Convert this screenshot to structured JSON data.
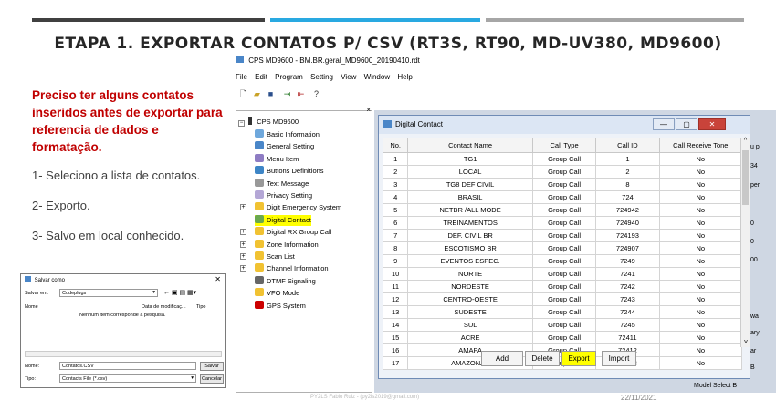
{
  "colors": {
    "bar1": "#404040",
    "bar2": "#29a9e1",
    "bar3": "#a6a6a6",
    "note": "#c00000",
    "highlight": "#ffff00"
  },
  "slide": {
    "title": "ETAPA 1. EXPORTAR CONTATOS P/ CSV (RT3S, RT90, MD-UV380, MD9600)",
    "note": "Preciso ter alguns contatos inseridos antes de exportar para referencia de dados e formatação.",
    "steps": [
      "1- Seleciono a lista de contatos.",
      "2- Exporto.",
      "3- Salvo em local conhecido."
    ],
    "footer_left": "PY2LS Fabio Ruiz - (py2ls2019@gmail.com)",
    "footer_date": "22/11/2021"
  },
  "save_dialog": {
    "title": "Salvar como",
    "close": "✕",
    "save_in_label": "Salvar em:",
    "save_in_value": "Codeplugs",
    "col_name": "Nome",
    "col_date": "Data de modificaç...",
    "col_type": "Tipo",
    "empty_message": "Nenhum item corresponde à pesquisa.",
    "filename_label": "Nome:",
    "filename_value": "Contatos.CSV",
    "type_label": "Tipo:",
    "type_value": "Contacts File (*.csv)",
    "save_button": "Salvar",
    "cancel_button": "Cancelar"
  },
  "cps": {
    "window_title": "CPS MD9600 - BM.BR.geral_MD9600_20190410.rdt",
    "menu": [
      "File",
      "Edit",
      "Program",
      "Setting",
      "View",
      "Window",
      "Help"
    ],
    "toolbar_icons": [
      "new-icon",
      "open-icon",
      "save-icon",
      "read-icon",
      "write-icon",
      "help-icon"
    ],
    "tree_root": "CPS MD9600",
    "tree": [
      {
        "label": "Basic Information",
        "icon": "basic-info-icon",
        "color": "#6fa8dc",
        "expandable": false
      },
      {
        "label": "General Setting",
        "icon": "general-setting-icon",
        "color": "#4a86c8",
        "expandable": false
      },
      {
        "label": "Menu Item",
        "icon": "menu-item-icon",
        "color": "#8e7cc3",
        "expandable": false
      },
      {
        "label": "Buttons Definitions",
        "icon": "buttons-icon",
        "color": "#3d85c6",
        "expandable": false
      },
      {
        "label": "Text Message",
        "icon": "text-message-icon",
        "color": "#999999",
        "expandable": false
      },
      {
        "label": "Privacy Setting",
        "icon": "privacy-icon",
        "color": "#b4a7d6",
        "expandable": false
      },
      {
        "label": "Digit Emergency System",
        "icon": "folder-icon",
        "color": "#f1c232",
        "expandable": true
      },
      {
        "label": "Digital Contact",
        "icon": "digital-contact-icon",
        "color": "#6aa84f",
        "expandable": false,
        "highlight": true
      },
      {
        "label": "Digital RX Group Call",
        "icon": "folder-icon",
        "color": "#f1c232",
        "expandable": true
      },
      {
        "label": "Zone Information",
        "icon": "folder-icon",
        "color": "#f1c232",
        "expandable": true
      },
      {
        "label": "Scan List",
        "icon": "folder-icon",
        "color": "#f1c232",
        "expandable": true
      },
      {
        "label": "Channel Information",
        "icon": "folder-icon",
        "color": "#f1c232",
        "expandable": true
      },
      {
        "label": "DTMF Signaling",
        "icon": "dtmf-icon",
        "color": "#666666",
        "expandable": false
      },
      {
        "label": "VFO Mode",
        "icon": "folder-icon",
        "color": "#f1c232",
        "expandable": false
      },
      {
        "label": "GPS System",
        "icon": "gps-icon",
        "color": "#cc0000",
        "expandable": false
      }
    ],
    "dialog_title": "Digital Contact",
    "columns": [
      "No.",
      "Contact Name",
      "Call Type",
      "Call ID",
      "Call Receive Tone"
    ],
    "rows": [
      [
        "1",
        "TG1",
        "Group Call",
        "1",
        "No"
      ],
      [
        "2",
        "LOCAL",
        "Group Call",
        "2",
        "No"
      ],
      [
        "3",
        "TG8 DEF CIVIL",
        "Group Call",
        "8",
        "No"
      ],
      [
        "4",
        "BRASIL",
        "Group Call",
        "724",
        "No"
      ],
      [
        "5",
        "NETBR /ALL MODE",
        "Group Call",
        "724942",
        "No"
      ],
      [
        "6",
        "TREINAMENTOS",
        "Group Call",
        "724940",
        "No"
      ],
      [
        "7",
        "DEF. CIVIL BR",
        "Group Call",
        "724193",
        "No"
      ],
      [
        "8",
        "ESCOTISMO BR",
        "Group Call",
        "724907",
        "No"
      ],
      [
        "9",
        "EVENTOS ESPEC.",
        "Group Call",
        "7249",
        "No"
      ],
      [
        "10",
        "NORTE",
        "Group Call",
        "7241",
        "No"
      ],
      [
        "11",
        "NORDESTE",
        "Group Call",
        "7242",
        "No"
      ],
      [
        "12",
        "CENTRO-OESTE",
        "Group Call",
        "7243",
        "No"
      ],
      [
        "13",
        "SUDESTE",
        "Group Call",
        "7244",
        "No"
      ],
      [
        "14",
        "SUL",
        "Group Call",
        "7245",
        "No"
      ],
      [
        "15",
        "ACRE",
        "Group Call",
        "72411",
        "No"
      ],
      [
        "16",
        "AMAPA",
        "Group Call",
        "72412",
        "No"
      ],
      [
        "17",
        "AMAZONAS",
        "Group Call",
        "72413",
        "No"
      ]
    ],
    "buttons": {
      "add": "Add",
      "delete": "Delete",
      "export": "Export",
      "import": "Import"
    },
    "window_buttons": {
      "minimize": "—",
      "maximize": "▢",
      "close": "✕"
    },
    "right_strip": [
      "u p",
      "34",
      "per",
      "0",
      "0",
      "00",
      "wa",
      "ary",
      "ar",
      "B"
    ],
    "model_select": "Model Select B"
  }
}
